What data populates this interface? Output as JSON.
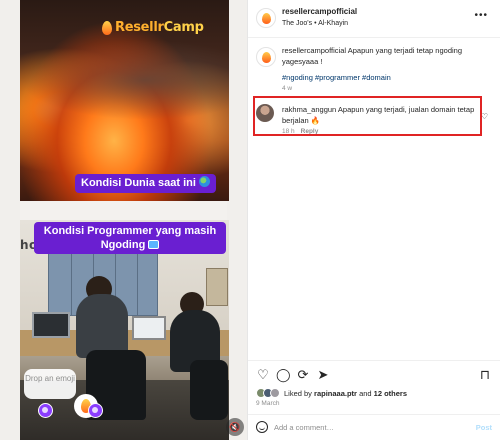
{
  "media": {
    "brand_logo": {
      "part1": "Resellr",
      "part2": "Camp"
    },
    "slide1_caption": "Kondisi Dunia saat ini",
    "slide2_caption": "Kondisi Programmer yang masih Ngoding",
    "office_sign": "host",
    "emoji_bubble": "Drop an emoji",
    "mute_icon": "speaker-muted-icon"
  },
  "post": {
    "username": "resellercampofficial",
    "subline": "The Joo's • Al-Khayin",
    "more_icon": "more-icon",
    "caption": {
      "author": "resellercampofficial",
      "text": "Apapun yang terjadi tetap ngoding yagesyaaa !",
      "hashtags": "#ngoding #programmer #domain",
      "time": "4 w"
    },
    "comment": {
      "author": "rakhma_anggun",
      "text": "Apapun yang terjadi, jualan domain tetap berjalan 🔥",
      "time": "18 h",
      "reply_label": "Reply"
    },
    "likes": {
      "prefix": "Liked by",
      "user": "rapinaaa.ptr",
      "conj": "and",
      "others": "12 others"
    },
    "date": "9 March",
    "add_comment_placeholder": "Add a comment…",
    "post_button": "Post"
  },
  "colors": {
    "highlight": "#e02424",
    "caption_pill": "#6a1fd1",
    "link": "#00376b"
  }
}
